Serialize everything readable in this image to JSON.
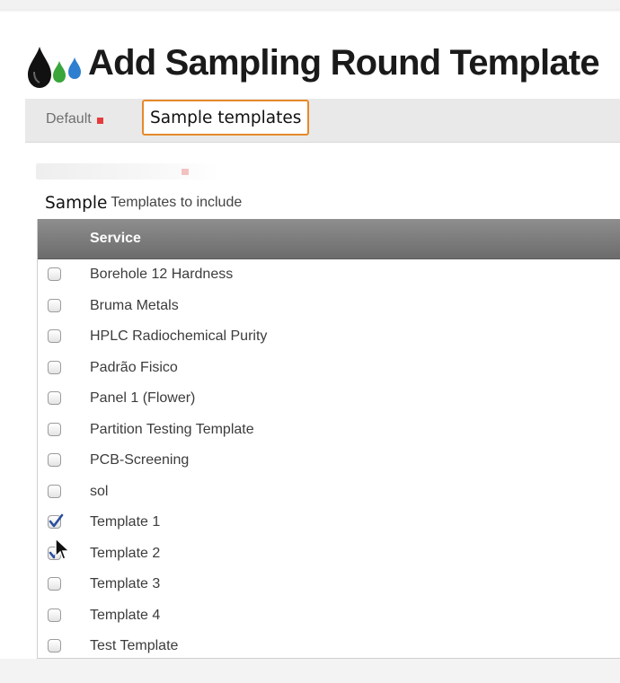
{
  "header": {
    "title": "Add Sampling Round Template",
    "logo_icon": "water-drops-icon"
  },
  "tabs": [
    {
      "label": "Default",
      "required": true,
      "active": false
    },
    {
      "label": "Sample templates",
      "active": true
    }
  ],
  "section": {
    "label_prefix": "Sample",
    "label": "Templates to include"
  },
  "table": {
    "columns": [
      "Service"
    ],
    "rows": [
      {
        "label": "Borehole 12 Hardness",
        "checked": false
      },
      {
        "label": "Bruma Metals",
        "checked": false
      },
      {
        "label": "HPLC Radiochemical Purity",
        "checked": false
      },
      {
        "label": "Padrão Fisico",
        "checked": false
      },
      {
        "label": "Panel 1 (Flower)",
        "checked": false
      },
      {
        "label": "Partition Testing Template",
        "checked": false
      },
      {
        "label": "PCB-Screening",
        "checked": false
      },
      {
        "label": "sol",
        "checked": false
      },
      {
        "label": "Template 1",
        "checked": true
      },
      {
        "label": "Template 2",
        "checked": true
      },
      {
        "label": "Template 3",
        "checked": false
      },
      {
        "label": "Template 4",
        "checked": false
      },
      {
        "label": "Test Template",
        "checked": false
      }
    ]
  },
  "colors": {
    "accent_orange": "#e58a2b",
    "required_red": "#e53b3b",
    "header_gray": "#7a7a7a",
    "check_blue": "#2a4f9e"
  }
}
